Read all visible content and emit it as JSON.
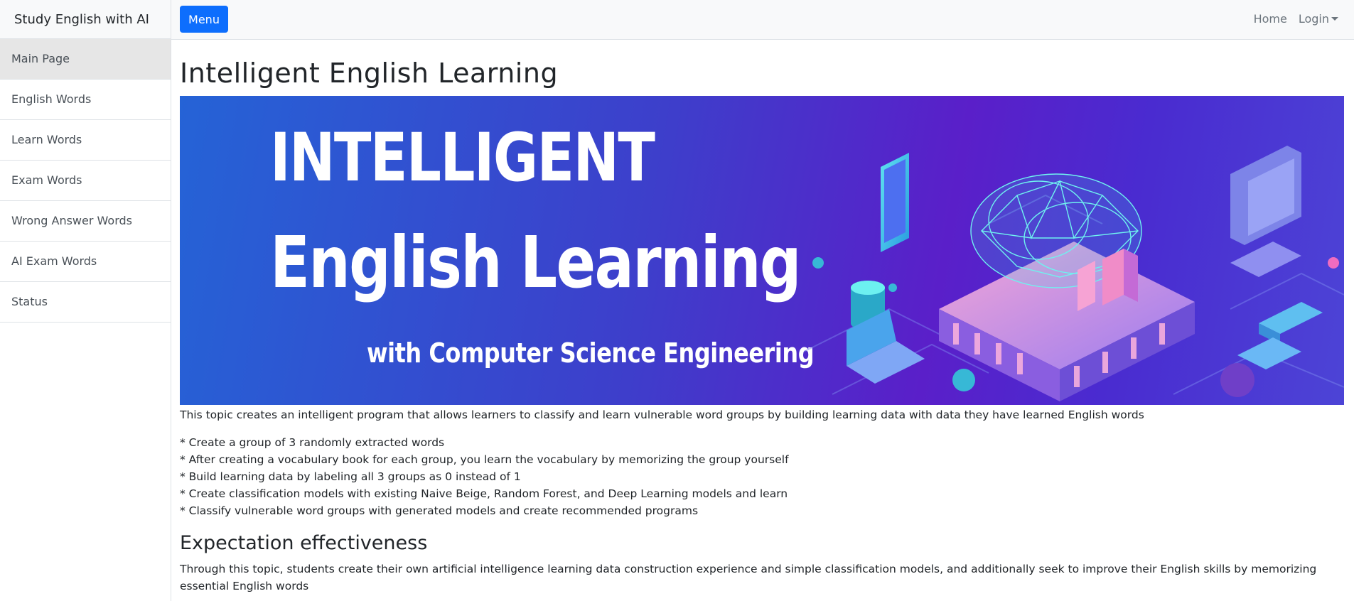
{
  "sidebar": {
    "brand": "Study English with AI",
    "items": [
      {
        "label": "Main Page",
        "active": true
      },
      {
        "label": "English Words"
      },
      {
        "label": "Learn Words"
      },
      {
        "label": "Exam Words"
      },
      {
        "label": "Wrong Answer Words"
      },
      {
        "label": "AI Exam Words"
      },
      {
        "label": "Status"
      }
    ]
  },
  "navbar": {
    "menu_label": "Menu",
    "home_label": "Home",
    "login_label": "Login"
  },
  "main": {
    "title": "Intelligent English Learning",
    "banner": {
      "line1": "INTELLIGENT",
      "line2": "English Learning",
      "line3": "with Computer Science Engineering"
    },
    "description": "This topic creates an intelligent program that allows learners to classify and learn vulnerable word groups by building learning data with data they have learned English words",
    "bullets": [
      "* Create a group of 3 randomly extracted words",
      "* After creating a vocabulary book for each group, you learn the vocabulary by memorizing the group yourself",
      "* Build learning data by labeling all 3 groups as 0 instead of 1",
      "* Create classification models with existing Naive Beige, Random Forest, and Deep Learning models and learn",
      "* Classify vulnerable word groups with generated models and create recommended programs"
    ],
    "subtitle": "Expectation effectiveness",
    "effectiveness": "Through this topic, students create their own artificial intelligence learning data construction experience and simple classification models, and additionally seek to improve their English skills by memorizing essential English words"
  },
  "colors": {
    "primary": "#0d6efd",
    "sidebar_active": "#e6e6e6",
    "navbar_bg": "#f8f9fa"
  }
}
